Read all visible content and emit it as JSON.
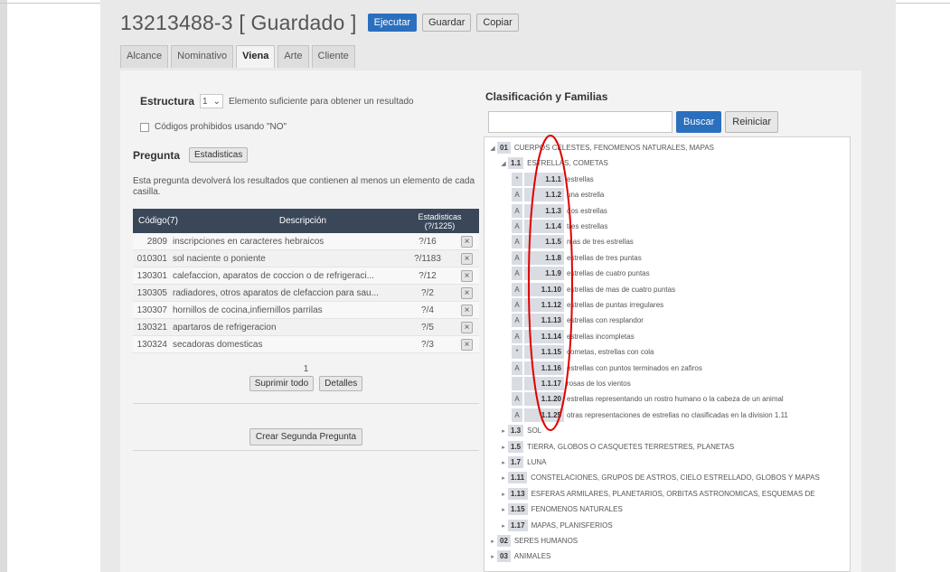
{
  "header": {
    "title": "13213488-3 [ Guardado ]",
    "btn_ejecutar": "Ejecutar",
    "btn_guardar": "Guardar",
    "btn_copiar": "Copiar"
  },
  "tabs": [
    "Alcance",
    "Nominativo",
    "Viena",
    "Arte",
    "Cliente"
  ],
  "structura": {
    "label": "Estructura",
    "select_value": "1",
    "help": "Elemento suficiente para obtener un resultado"
  },
  "checkbox_label": "Códigos prohibidos usando \"NO\"",
  "pregunta": {
    "label": "Pregunta",
    "stats_button": "Estadisticas",
    "description": "Esta pregunta devolverá los resultados que contienen al menos un elemento de cada casilla."
  },
  "table": {
    "col_code": "Código(7)",
    "col_desc": "Descripción",
    "col_stats": "Estadisticas",
    "col_stats_sub": "(?/1225)",
    "rows": [
      {
        "code": "2809",
        "desc": "inscripciones en caracteres hebraicos",
        "stats": "?/16"
      },
      {
        "code": "010301",
        "desc": "sol naciente o poniente",
        "stats": "?/1183"
      },
      {
        "code": "130301",
        "desc": "calefaccion, aparatos de coccion o de refrigeraci...",
        "stats": "?/12"
      },
      {
        "code": "130305",
        "desc": "radiadores, otros aparatos de clefaccion para sau...",
        "stats": "?/2"
      },
      {
        "code": "130307",
        "desc": "hornillos de cocina,infiernillos parrilas",
        "stats": "?/4"
      },
      {
        "code": "130321",
        "desc": "apartaros de refrigeracion",
        "stats": "?/5"
      },
      {
        "code": "130324",
        "desc": "secadoras domesticas",
        "stats": "?/3"
      }
    ]
  },
  "count": "1",
  "actions": {
    "suprimir": "Suprimir todo",
    "detalles": "Detalles",
    "segunda": "Crear Segunda Pregunta"
  },
  "right": {
    "title": "Clasificación y Familias",
    "search_value": "",
    "btn_buscar": "Buscar",
    "btn_reiniciar": "Reiniciar"
  },
  "tree": {
    "root": {
      "code": "01",
      "label": "CUERPOS CELESTES, FENOMENOS NATURALES, MAPAS"
    },
    "sub": {
      "code": "1.1",
      "label": "ESTRELLAS, COMETAS"
    },
    "leaves": [
      {
        "mark": "*",
        "code": "1.1.1",
        "label": "estrellas"
      },
      {
        "mark": "A",
        "code": "1.1.2",
        "label": "una estrella"
      },
      {
        "mark": "A",
        "code": "1.1.3",
        "label": "dos estrellas"
      },
      {
        "mark": "A",
        "code": "1.1.4",
        "label": "tres estrellas"
      },
      {
        "mark": "A",
        "code": "1.1.5",
        "label": "mas de tres estrellas"
      },
      {
        "mark": "A",
        "code": "1.1.8",
        "label": "estrellas de tres puntas"
      },
      {
        "mark": "A",
        "code": "1.1.9",
        "label": "estrellas de cuatro puntas"
      },
      {
        "mark": "A",
        "code": "1.1.10",
        "label": "estrellas de mas de cuatro puntas"
      },
      {
        "mark": "A",
        "code": "1.1.12",
        "label": "estrellas de puntas irregulares"
      },
      {
        "mark": "A",
        "code": "1.1.13",
        "label": "estrellas con resplandor"
      },
      {
        "mark": "A",
        "code": "1.1.14",
        "label": "estrellas incompletas"
      },
      {
        "mark": "*",
        "code": "1.1.15",
        "label": "cometas, estrellas con cola"
      },
      {
        "mark": "A",
        "code": "1.1.16",
        "label": "estrellas con puntos terminados en zafiros"
      },
      {
        "mark": "",
        "code": "1.1.17",
        "label": "rosas de los vientos"
      },
      {
        "mark": "A",
        "code": "1.1.20",
        "label": "estrellas representando un rostro humano o la cabeza de un animal"
      },
      {
        "mark": "A",
        "code": "1.1.25",
        "label": "otras representaciones de estrellas no clasificadas en la division 1.11"
      }
    ],
    "siblings": [
      {
        "code": "1.3",
        "label": "SOL"
      },
      {
        "code": "1.5",
        "label": "TIERRA, GLOBOS O CASQUETES TERRESTRES, PLANETAS"
      },
      {
        "code": "1.7",
        "label": "LUNA"
      },
      {
        "code": "1.11",
        "label": "CONSTELACIONES, GRUPOS DE ASTROS, CIELO ESTRELLADO, GLOBOS Y MAPAS"
      },
      {
        "code": "1.13",
        "label": "ESFERAS ARMILARES, PLANETARIOS, ORBITAS ASTRONOMICAS, ESQUEMAS DE"
      },
      {
        "code": "1.15",
        "label": "FENOMENOS NATURALES"
      },
      {
        "code": "1.17",
        "label": "MAPAS, PLANISFERIOS"
      }
    ],
    "top_level": [
      {
        "code": "02",
        "label": "SERES HUMANOS"
      },
      {
        "code": "03",
        "label": "ANIMALES"
      }
    ]
  },
  "colors": {
    "primary": "#2b6fbf",
    "table_header": "#3a4759",
    "annotation": "#e00000"
  }
}
